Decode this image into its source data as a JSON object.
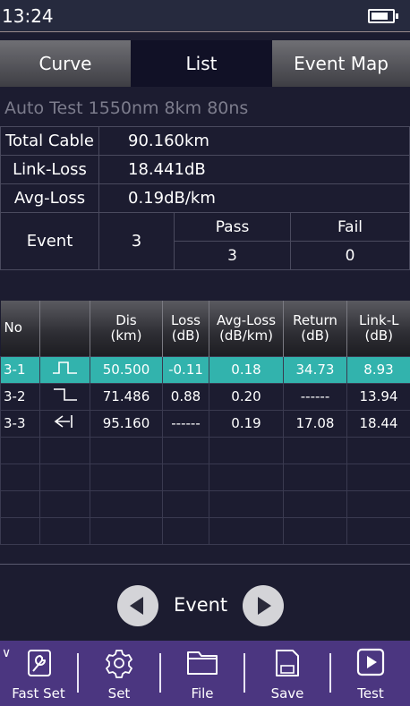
{
  "status": {
    "time": "13:24",
    "battery_level": 0.7
  },
  "tabs": [
    {
      "label": "Curve"
    },
    {
      "label": "List"
    },
    {
      "label": "Event Map"
    }
  ],
  "auto_test": "Auto Test  1550nm  8km  80ns",
  "summary": {
    "total_cable_label": "Total Cable",
    "total_cable_value": "90.160km",
    "link_loss_label": "Link-Loss",
    "link_loss_value": "18.441dB",
    "avg_loss_label": "Avg-Loss",
    "avg_loss_value": "0.19dB/km",
    "event_label": "Event",
    "event_count": "3",
    "pass_label": "Pass",
    "fail_label": "Fail",
    "pass_count": "3",
    "fail_count": "0"
  },
  "events_table": {
    "headers": {
      "no": "No",
      "type": "",
      "dis": "Dis",
      "dis_unit": "(km)",
      "loss": "Loss",
      "loss_unit": "(dB)",
      "avg_loss": "Avg-Loss",
      "avg_loss_unit": "(dB/km)",
      "return": "Return",
      "return_unit": "(dB)",
      "link_l": "Link-L",
      "link_l_unit": "(dB)"
    },
    "rows": [
      {
        "no": "3-1",
        "type_icon": "reflective-event-icon",
        "dis": "50.500",
        "loss": "-0.11",
        "avg_loss": "0.18",
        "return": "34.73",
        "link_l": "8.93"
      },
      {
        "no": "3-2",
        "type_icon": "non-reflective-event-icon",
        "dis": "71.486",
        "loss": "0.88",
        "avg_loss": "0.20",
        "return": "------",
        "link_l": "13.94"
      },
      {
        "no": "3-3",
        "type_icon": "end-event-icon",
        "dis": "95.160",
        "loss": "------",
        "avg_loss": "0.19",
        "return": "17.08",
        "link_l": "18.44"
      }
    ],
    "selected_row": 0,
    "selected_color": "#32b3ad"
  },
  "event_nav": {
    "label": "Event"
  },
  "bottom_bar": {
    "fast_set": "Fast Set",
    "set": "Set",
    "file": "File",
    "save": "Save",
    "test": "Test",
    "color": "#4b3680"
  }
}
